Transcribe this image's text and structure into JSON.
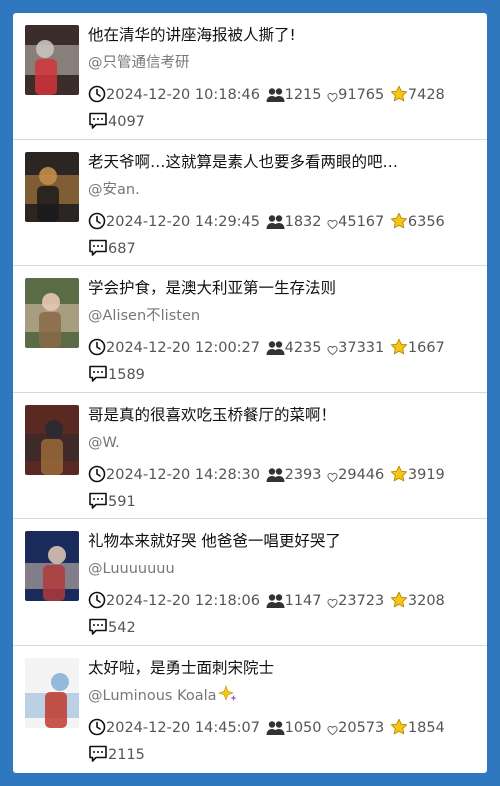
{
  "posts": [
    {
      "title": "他在清华的讲座海报被人撕了!",
      "author": "@只管通信考研",
      "time": "2024-12-20 10:18:46",
      "views": "1215",
      "likes": "91765",
      "favorites": "7428",
      "comments": "4097",
      "thumb_colors": [
        "#3b2d2a",
        "#c9c3bd",
        "#d4343b"
      ]
    },
    {
      "title": "老天爷啊…这就算是素人也要多看两眼的吧…",
      "author": "@安an.",
      "time": "2024-12-20 14:29:45",
      "views": "1832",
      "likes": "45167",
      "favorites": "6356",
      "comments": "687",
      "thumb_colors": [
        "#2c2622",
        "#c48d47",
        "#1b1b1b"
      ]
    },
    {
      "title": "学会护食，是澳大利亚第一生存法则",
      "author": "@Alisen不listen",
      "time": "2024-12-20 12:00:27",
      "views": "4235",
      "likes": "37331",
      "favorites": "1667",
      "comments": "1589",
      "thumb_colors": [
        "#5a6b46",
        "#e8c8b4",
        "#8a6a4a"
      ]
    },
    {
      "title": "哥是真的很喜欢吃玉桥餐厅的菜啊！",
      "author": "@W.",
      "time": "2024-12-20 14:28:30",
      "views": "2393",
      "likes": "29446",
      "favorites": "3919",
      "comments": "591",
      "thumb_colors": [
        "#5a2a22",
        "#2a2a30",
        "#9a6a3a"
      ]
    },
    {
      "title": "礼物本来就好哭 他爸爸一唱更好哭了",
      "author": "@Luuuuuuu",
      "time": "2024-12-20 12:18:06",
      "views": "1147",
      "likes": "23723",
      "favorites": "3208",
      "comments": "542",
      "thumb_colors": [
        "#1a2a5a",
        "#d9c2b0",
        "#b23a3a"
      ]
    },
    {
      "title": "太好啦，是勇士面刺宋院士",
      "author": "@Luminous Koala",
      "author_has_sparkle": true,
      "time": "2024-12-20 14:45:07",
      "views": "1050",
      "likes": "20573",
      "favorites": "1854",
      "comments": "2115",
      "thumb_colors": [
        "#f4f4f4",
        "#8ab4d8",
        "#c0392b"
      ]
    }
  ],
  "icons": {
    "time": "clock-icon",
    "views": "people-icon",
    "likes": "heart-icon",
    "favorites": "star-icon",
    "comments": "comment-icon"
  },
  "colors": {
    "background": "#2f78bf",
    "card": "#ffffff",
    "star": "#f5c518"
  }
}
